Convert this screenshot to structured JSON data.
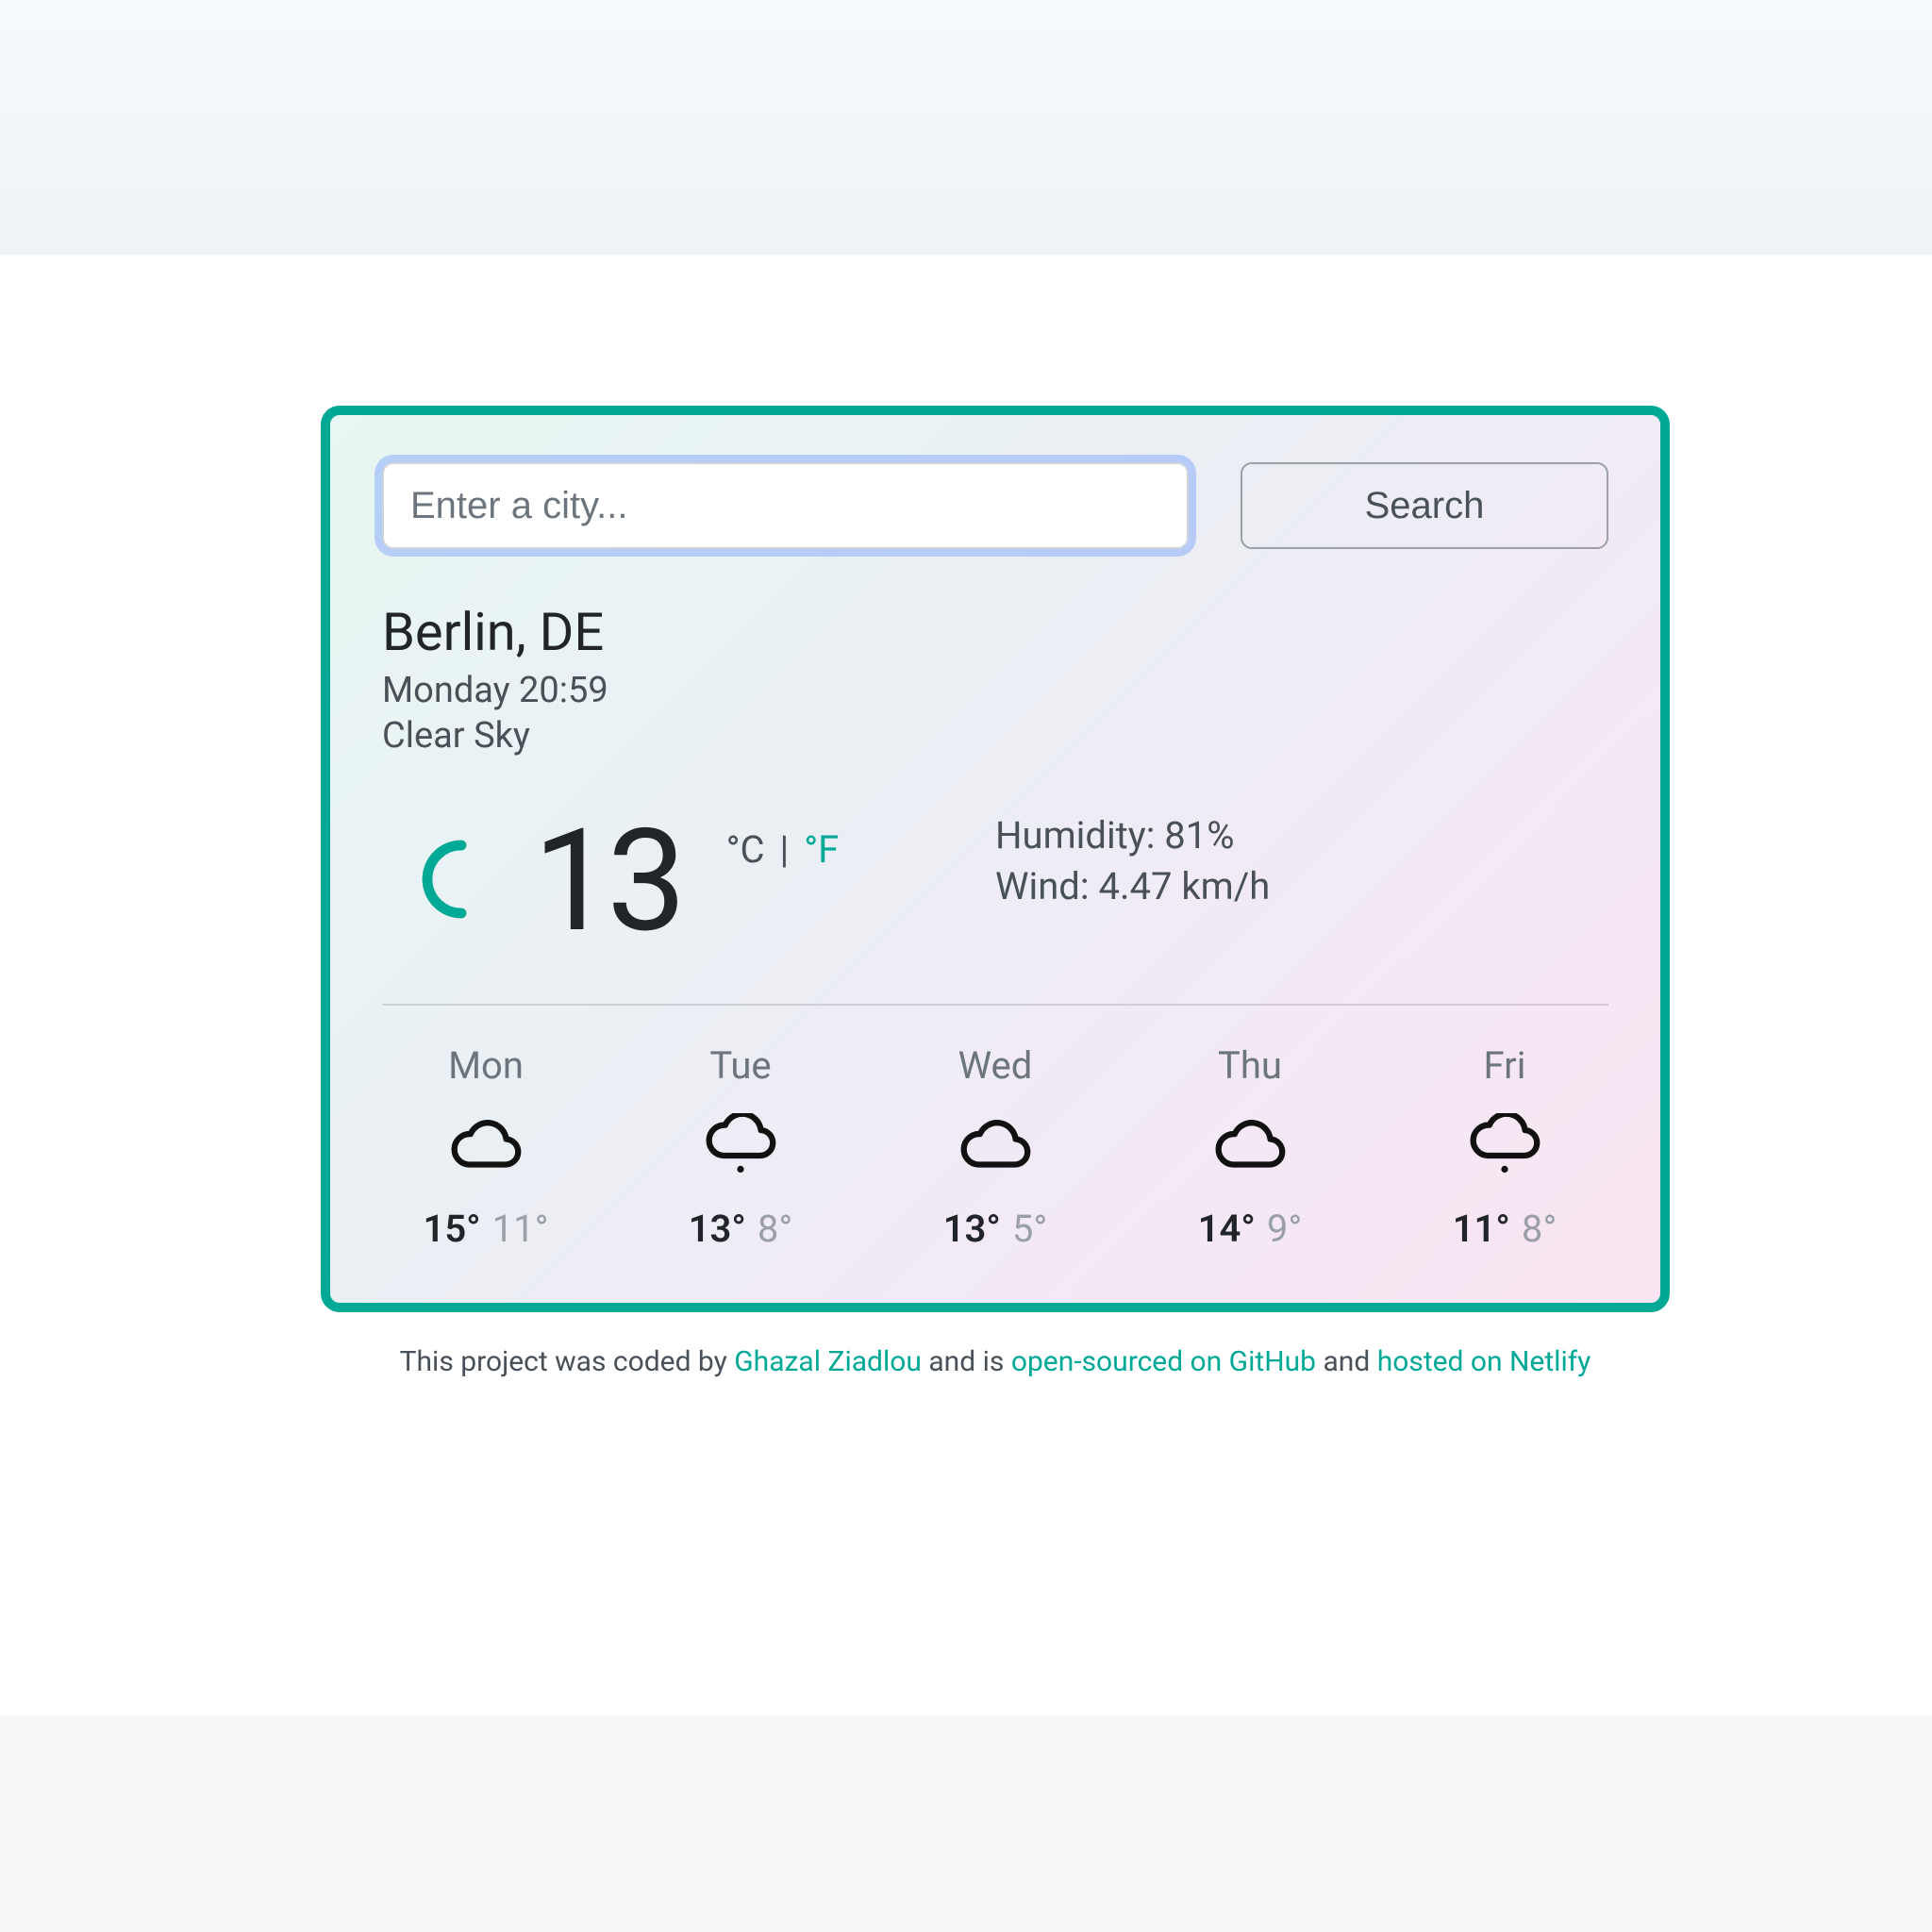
{
  "search": {
    "placeholder": "Enter a city...",
    "button_label": "Search"
  },
  "current": {
    "city": "Berlin, DE",
    "datetime": "Monday 20:59",
    "description": "Clear Sky",
    "temperature": "13",
    "unit_c": "°C",
    "unit_sep": " | ",
    "unit_f": "°F",
    "humidity_label": "Humidity: ",
    "humidity_value": "81%",
    "wind_label": "Wind: ",
    "wind_value": "4.47 km/h",
    "icon": "clear-night"
  },
  "forecast": [
    {
      "day": "Mon",
      "icon": "cloud",
      "hi": "15°",
      "lo": "11°"
    },
    {
      "day": "Tue",
      "icon": "cloud-rain",
      "hi": "13°",
      "lo": "8°"
    },
    {
      "day": "Wed",
      "icon": "cloud",
      "hi": "13°",
      "lo": "5°"
    },
    {
      "day": "Thu",
      "icon": "cloud",
      "hi": "14°",
      "lo": "9°"
    },
    {
      "day": "Fri",
      "icon": "cloud-rain",
      "hi": "11°",
      "lo": "8°"
    }
  ],
  "footer": {
    "t1": "This project was coded by ",
    "link1": "Ghazal Ziadlou",
    "t2": " and is ",
    "link2": "open-sourced on GitHub",
    "t3": " and ",
    "link3": "hosted on Netlify"
  }
}
